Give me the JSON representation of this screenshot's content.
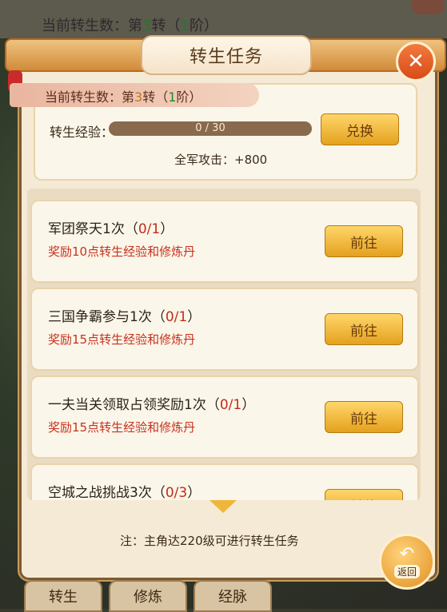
{
  "background": {
    "top_text_prefix": "当前转生数：第",
    "top_text_num": "3",
    "top_text_mid": "转（",
    "top_text_stage": "1",
    "top_text_suffix": "阶）"
  },
  "dialog": {
    "title": "转生任务",
    "close_icon": "close-icon"
  },
  "info": {
    "banner_prefix": "当前转生数：第",
    "rebirth_count": "3",
    "banner_mid": "转（",
    "stage": "1",
    "banner_suffix": "阶）",
    "exp_label": "转生经验：",
    "exp_text": "0 / 30",
    "exp_progress": 0,
    "exchange_button": "兑换",
    "attack_bonus": "全军攻击：+800"
  },
  "tasks": [
    {
      "title": "军团祭天1次（",
      "progress": "0/1",
      "title_end": "）",
      "reward": "奖励10点转生经验和修炼丹",
      "button": "前往"
    },
    {
      "title": "三国争霸参与1次（",
      "progress": "0/1",
      "title_end": "）",
      "reward": "奖励15点转生经验和修炼丹",
      "button": "前往"
    },
    {
      "title": "一夫当关领取占领奖励1次（",
      "progress": "0/1",
      "title_end": "）",
      "reward": "奖励15点转生经验和修炼丹",
      "button": "前往"
    },
    {
      "title": "空城之战挑战3次（",
      "progress": "0/3",
      "title_end": "）",
      "reward": "",
      "button": "前往"
    }
  ],
  "note": "注：主角达220级可进行转生任务",
  "back_button": "返回",
  "bottom_tabs": [
    "转生",
    "修炼",
    "经脉"
  ]
}
